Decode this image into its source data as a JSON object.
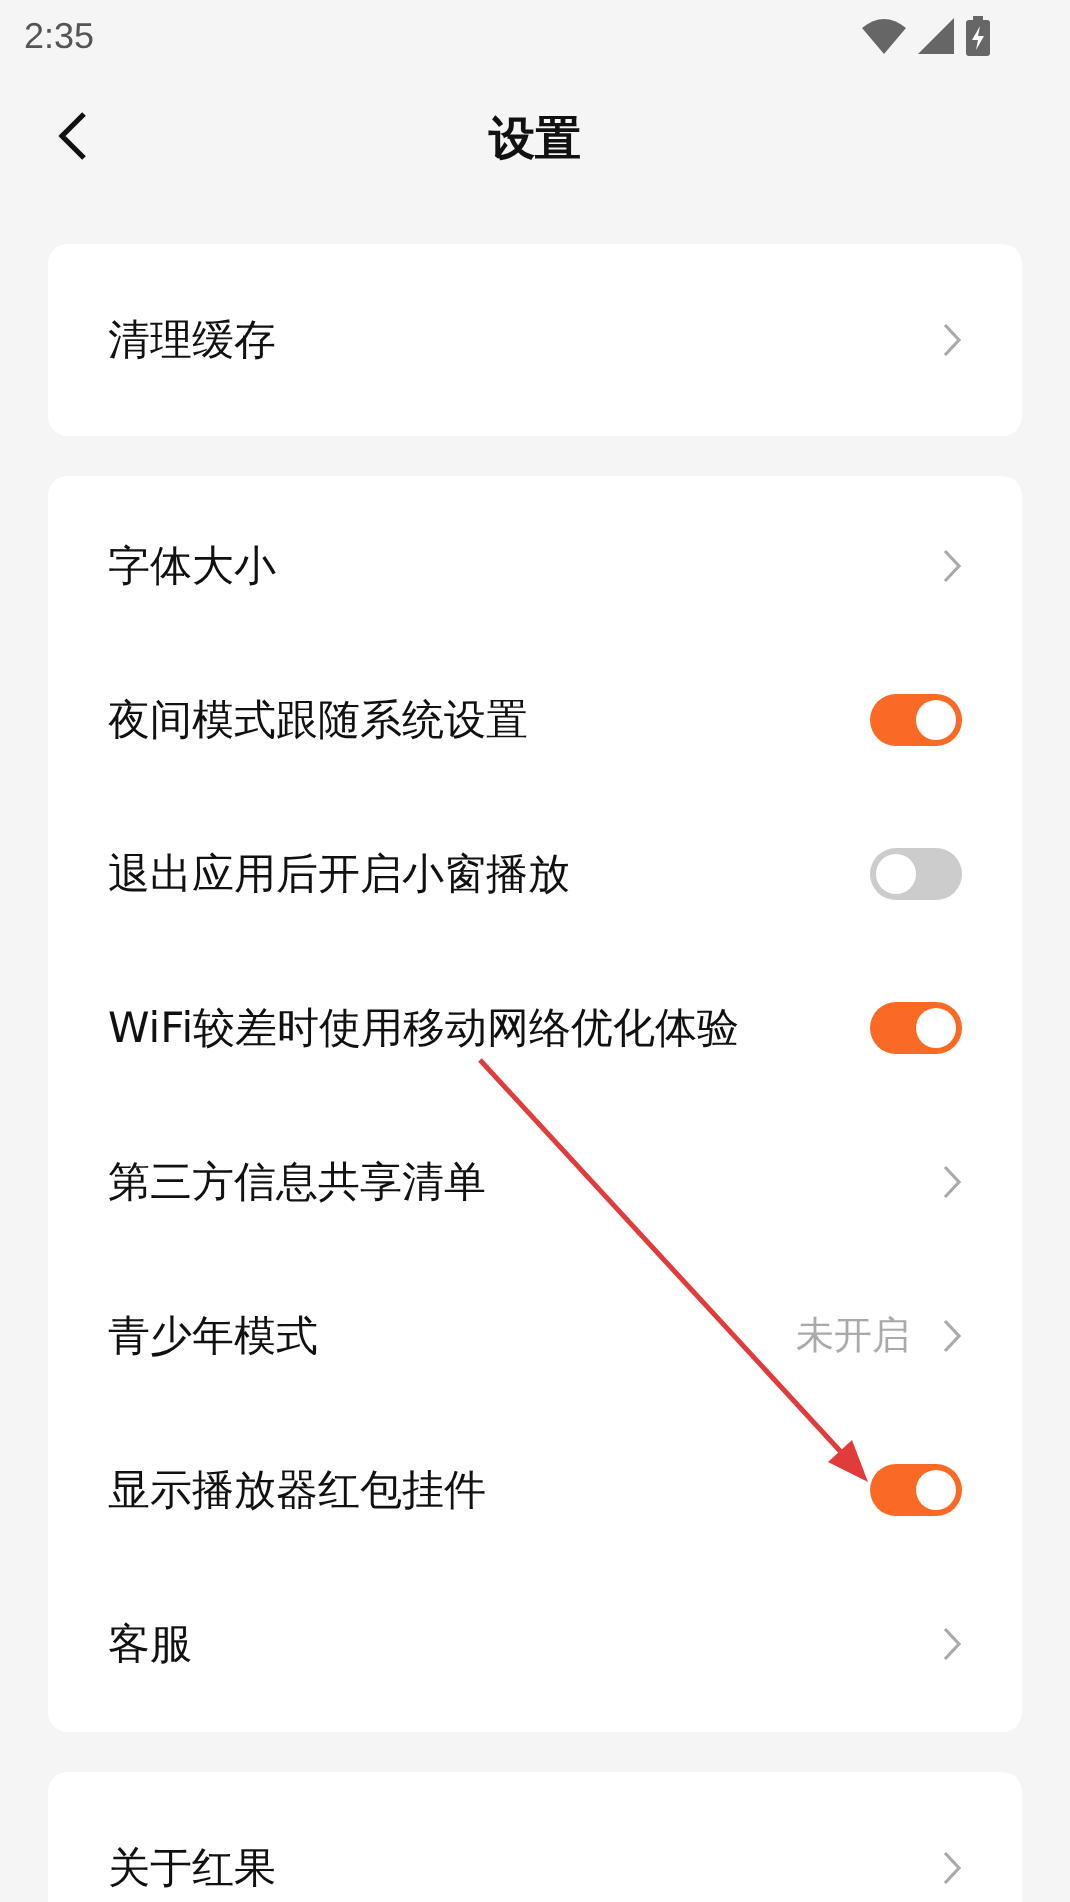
{
  "status_bar": {
    "time": "2:35"
  },
  "header": {
    "title": "设置"
  },
  "sections": [
    {
      "rows": [
        {
          "kind": "link",
          "label": "清理缓存"
        }
      ]
    },
    {
      "rows": [
        {
          "kind": "link",
          "label": "字体大小"
        },
        {
          "kind": "toggle",
          "label": "夜间模式跟随系统设置",
          "on": true
        },
        {
          "kind": "toggle",
          "label": "退出应用后开启小窗播放",
          "on": false
        },
        {
          "kind": "toggle",
          "label": "WiFi较差时使用移动网络优化体验",
          "on": true
        },
        {
          "kind": "link",
          "label": "第三方信息共享清单"
        },
        {
          "kind": "link",
          "label": "青少年模式",
          "value": "未开启"
        },
        {
          "kind": "toggle",
          "label": "显示播放器红包挂件",
          "on": true
        },
        {
          "kind": "link",
          "label": "客服"
        }
      ]
    },
    {
      "rows": [
        {
          "kind": "link",
          "label": "关于红果"
        }
      ]
    }
  ]
}
